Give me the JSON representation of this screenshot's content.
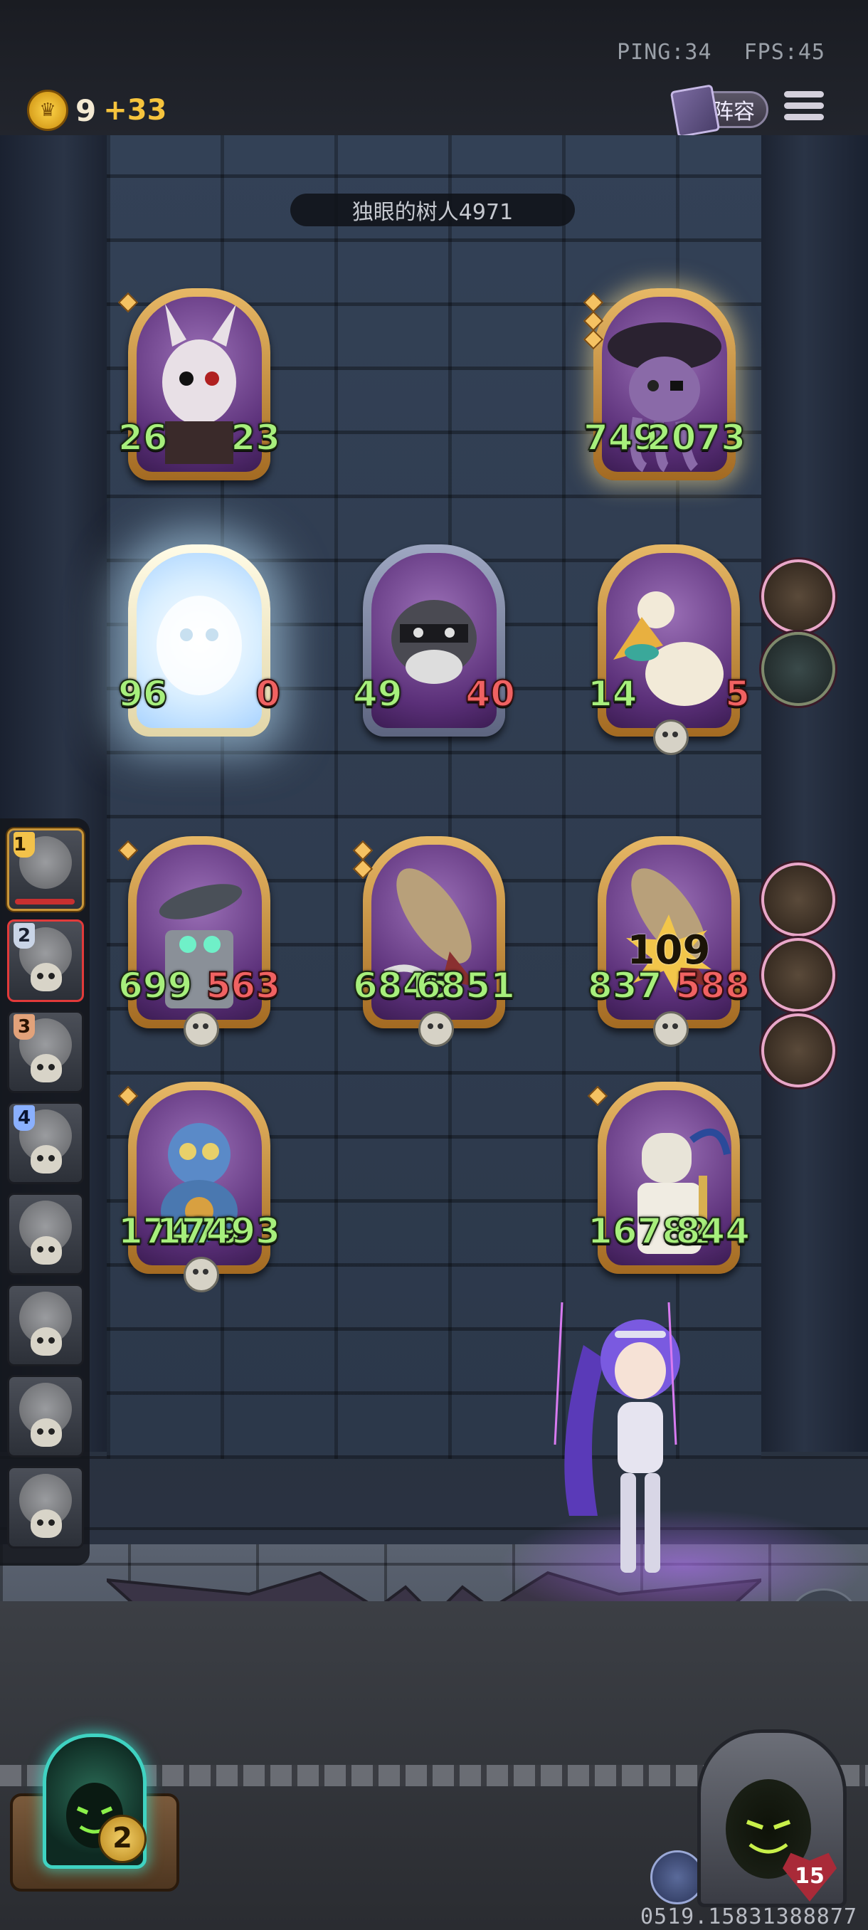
{
  "topbar": {
    "ping": "PING:34",
    "fps": "FPS:45",
    "gold": "9",
    "gold_income": "+33",
    "lineup_label": "阵容"
  },
  "enemy": {
    "name": "独眼的树人4971"
  },
  "cards": {
    "enemy_left": {
      "atk": "26",
      "hp": "23"
    },
    "enemy_right": {
      "atk": "749",
      "hp": "2073"
    },
    "row2_a": {
      "atk": "96",
      "hp": "0"
    },
    "row2_b": {
      "atk": "49",
      "hp": "40"
    },
    "row2_c": {
      "atk": "14",
      "hp": "5"
    },
    "row3_a": {
      "atk": "699",
      "hp": "563"
    },
    "row3_b": {
      "atk": "6845",
      "hp": "6851"
    },
    "row3_c": {
      "atk": "837",
      "hp": "588",
      "damage": "109"
    },
    "row4_a": {
      "atk": "17479",
      "hp": "17493"
    },
    "row4_c": {
      "atk": "16782",
      "hp": "844"
    }
  },
  "turn_order": [
    {
      "order": "1"
    },
    {
      "order": "2"
    },
    {
      "order": "3"
    },
    {
      "order": "4"
    }
  ],
  "bottom": {
    "portal_count": "2",
    "lives": "15",
    "room_id": "0519.15831388877"
  },
  "icons": [
    "coin-icon",
    "lineup-book-icon",
    "menu-icon",
    "chat-icon",
    "shield-icon",
    "heart-icon",
    "skull-icon"
  ]
}
